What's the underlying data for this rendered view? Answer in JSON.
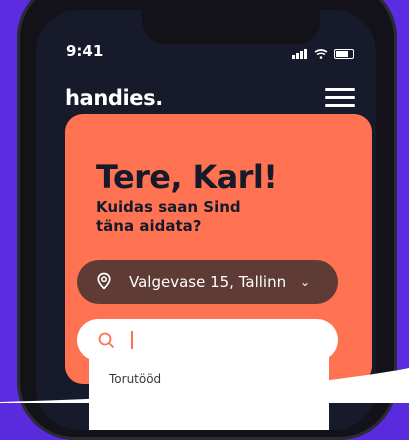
{
  "status": {
    "time": "9:41"
  },
  "app": {
    "name": "handies."
  },
  "greeting": {
    "title": "Tere, Karl!",
    "subtitle": "Kuidas saan Sind täna aidata?"
  },
  "location": {
    "value": "Valgevase 15, Tallinn"
  },
  "search": {
    "value": "",
    "placeholder": ""
  },
  "suggestions": [
    {
      "label": "Torutööd"
    }
  ],
  "colors": {
    "background": "#5b2ce0",
    "card": "#ff7352",
    "screen": "#171a2b",
    "pill": "#5f3b36"
  }
}
